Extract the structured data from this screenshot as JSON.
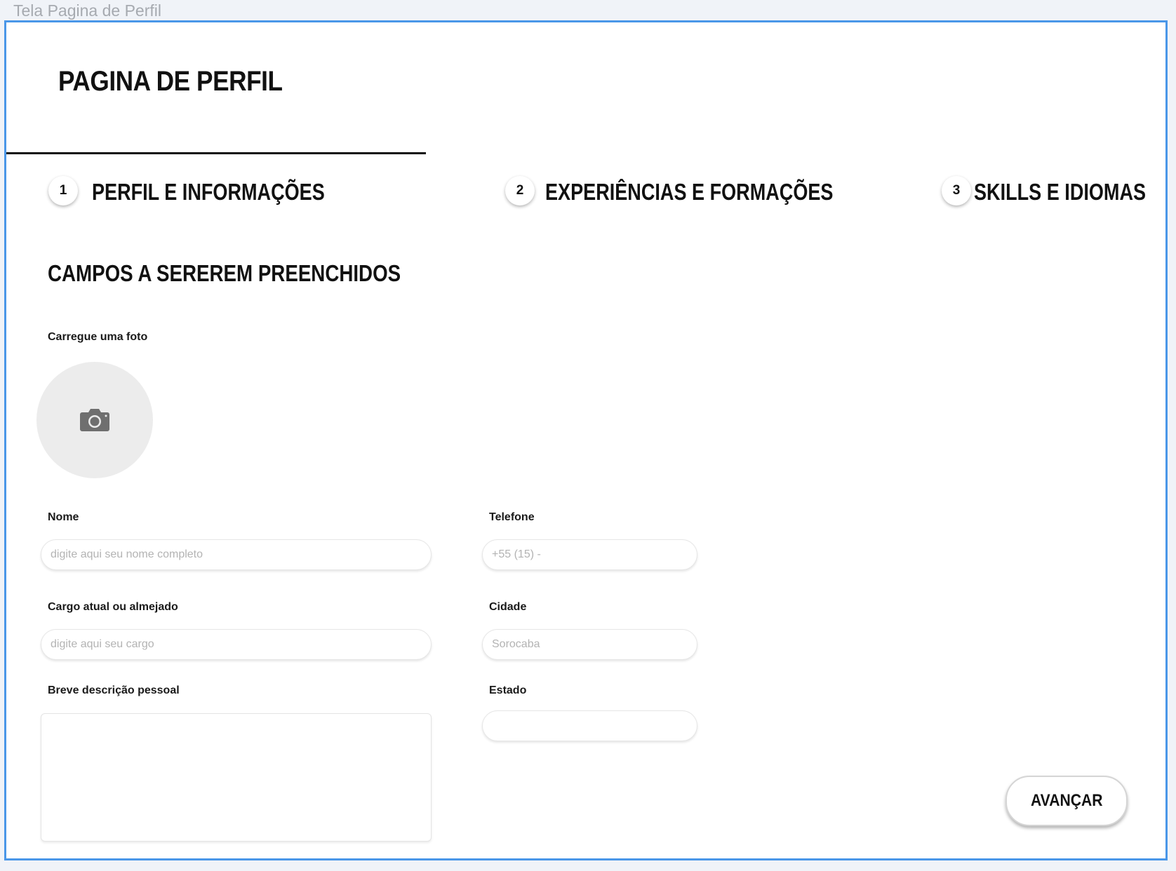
{
  "frame": {
    "label": "Tela Pagina de Perfil"
  },
  "header": {
    "title": "PAGINA DE PERFIL"
  },
  "steps": [
    {
      "number": "1",
      "label": "PERFIL E INFORMAÇÕES"
    },
    {
      "number": "2",
      "label": "EXPERIÊNCIAS E FORMAÇÕES"
    },
    {
      "number": "3",
      "label": "SKILLS E IDIOMAS"
    }
  ],
  "form": {
    "section_title": "CAMPOS A SEREREM PREENCHIDOS",
    "photo": {
      "label": "Carregue uma foto",
      "icon": "camera-icon"
    },
    "nome": {
      "label": "Nome",
      "placeholder": "digite aqui seu nome completo",
      "value": ""
    },
    "telefone": {
      "label": "Telefone",
      "placeholder": "+55 (15) -",
      "value": ""
    },
    "cargo": {
      "label": "Cargo atual ou almejado",
      "placeholder": "digite aqui seu cargo",
      "value": ""
    },
    "cidade": {
      "label": "Cidade",
      "placeholder": "Sorocaba",
      "value": ""
    },
    "descricao": {
      "label": "Breve descrição pessoal",
      "value": ""
    },
    "estado": {
      "label": "Estado",
      "value": ""
    }
  },
  "actions": {
    "next_label": "AVANÇAR"
  },
  "colors": {
    "frame_border": "#4a97e8",
    "background": "#f0f3f8",
    "text": "#111111"
  }
}
